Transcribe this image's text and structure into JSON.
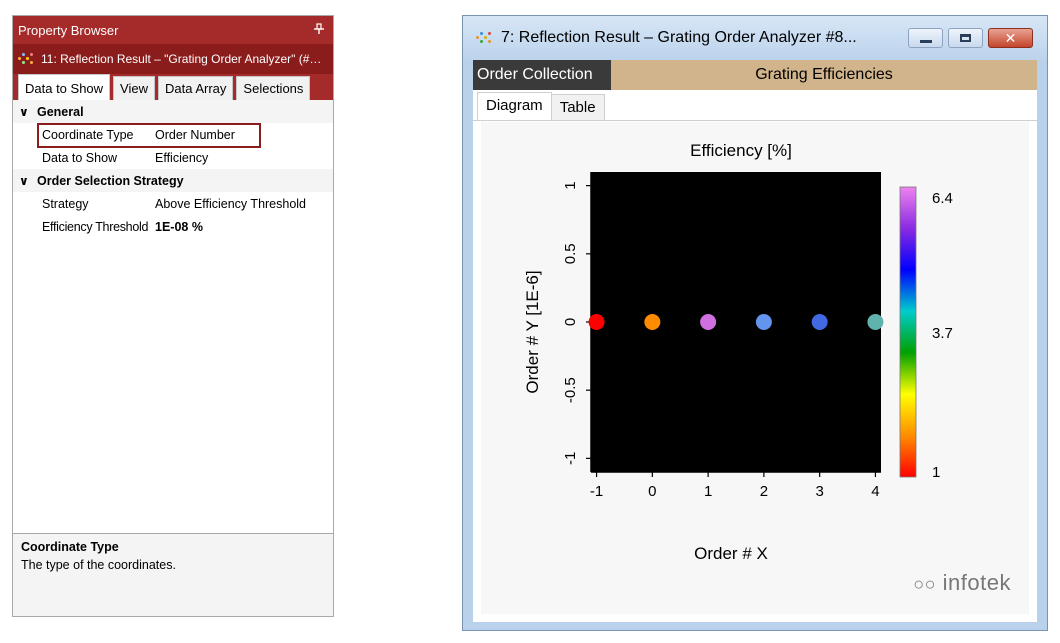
{
  "property_browser": {
    "title": "Property Browser",
    "pin_icon": "pin-icon",
    "document_title": "11: Reflection Result – \"Grating Order Analyzer\" (#…",
    "tabs": [
      {
        "label": "Data to Show",
        "active": true
      },
      {
        "label": "View",
        "active": false
      },
      {
        "label": "Data Array",
        "active": false
      },
      {
        "label": "Selections",
        "active": false
      }
    ],
    "sections": [
      {
        "title": "General",
        "rows": [
          {
            "key": "Coordinate Type",
            "value": "Order Number"
          },
          {
            "key": "Data to Show",
            "value": "Efficiency"
          }
        ]
      },
      {
        "title": "Order Selection Strategy",
        "rows": [
          {
            "key": "Strategy",
            "value": "Above Efficiency Threshold"
          },
          {
            "key": "Efficiency Threshold",
            "value": "1E-08 %"
          }
        ]
      }
    ],
    "help": {
      "title": "Coordinate Type",
      "text": "The type of the coordinates."
    },
    "accent_color": "#a52a2a"
  },
  "result_window": {
    "title": "7: Reflection Result – Grating Order Analyzer #8...",
    "header_left": "Order Collection",
    "header_right": "Grating Efficiencies",
    "tabs": [
      {
        "label": "Diagram",
        "active": true
      },
      {
        "label": "Table",
        "active": false
      }
    ],
    "watermark": "infotek"
  },
  "chart_data": {
    "type": "scatter",
    "title": "Efficiency  [%]",
    "xlabel": "Order # X",
    "ylabel": "Order # Y [1E-6]",
    "xlim": [
      -1.1,
      4.1
    ],
    "ylim": [
      -1.1,
      1.1
    ],
    "x_ticks": [
      -1,
      0,
      1,
      2,
      3,
      4
    ],
    "y_ticks": [
      -1,
      -0.5,
      0,
      0.5,
      1
    ],
    "x_tick_labels": [
      "-1",
      "0",
      "1",
      "2",
      "3",
      "4"
    ],
    "y_tick_labels": [
      "-1",
      "-0.5",
      "0",
      "0.5",
      "1"
    ],
    "points": [
      {
        "x": -1,
        "y": 0,
        "color": "#ff0000"
      },
      {
        "x": 0,
        "y": 0,
        "color": "#ff8c00"
      },
      {
        "x": 1,
        "y": 0,
        "color": "#d070e0"
      },
      {
        "x": 2,
        "y": 0,
        "color": "#6495ed"
      },
      {
        "x": 3,
        "y": 0,
        "color": "#4169e1"
      },
      {
        "x": 4,
        "y": 0,
        "color": "#5fb3ac"
      }
    ],
    "colorbar": {
      "min": 1,
      "max": 6.4,
      "tick_values": [
        1,
        3.7,
        6.4
      ],
      "tick_labels": [
        "1",
        "3.7",
        "6.4"
      ],
      "colors": [
        "#ff0000",
        "#ff8c00",
        "#ffff00",
        "#00a000",
        "#00cccc",
        "#0000ff",
        "#8a2be2",
        "#ee82ee"
      ]
    },
    "background": "#000000",
    "grid": false,
    "legend": "colorbar-right"
  }
}
